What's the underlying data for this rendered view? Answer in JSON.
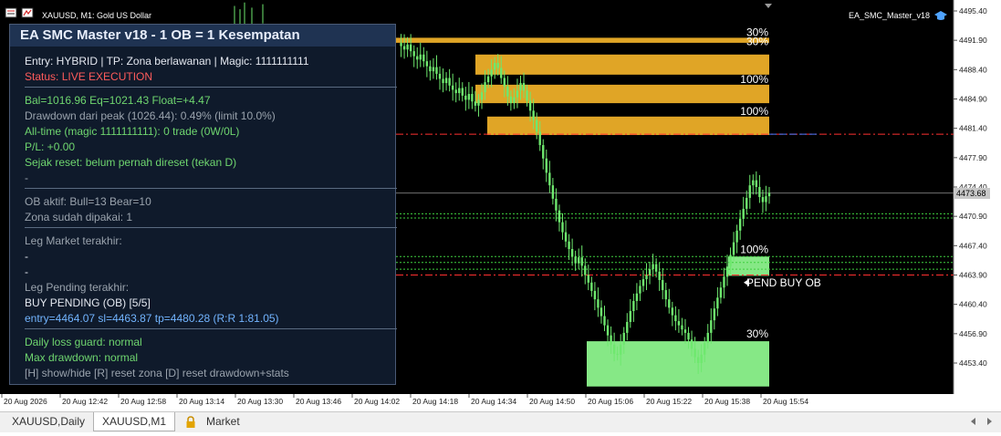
{
  "window": {
    "symbol_title": "XAUUSD, M1:  Gold US Dollar",
    "ea_label": "EA_SMC_Master_v18",
    "current_price": "4473.68"
  },
  "price_axis": {
    "ticks": [
      "4495.40",
      "4491.90",
      "4488.40",
      "4484.90",
      "4481.40",
      "4477.90",
      "4474.40",
      "4470.90",
      "4467.40",
      "4463.90",
      "4460.40",
      "4456.90",
      "4453.40"
    ]
  },
  "time_axis": {
    "ticks": [
      "20 Aug 2026",
      "20 Aug 12:42",
      "20 Aug 12:58",
      "20 Aug 13:14",
      "20 Aug 13:30",
      "20 Aug 13:46",
      "20 Aug 14:02",
      "20 Aug 14:18",
      "20 Aug 14:34",
      "20 Aug 14:50",
      "20 Aug 15:06",
      "20 Aug 15:22",
      "20 Aug 15:38",
      "20 Aug 15:54"
    ]
  },
  "zones": {
    "bear": [
      {
        "label": "30%",
        "label2": "30%",
        "top": 4492.2,
        "bottom": 4491.6
      },
      {
        "label": "",
        "label2": "",
        "top": 4490.2,
        "bottom": 4487.8
      },
      {
        "label": "100%",
        "label2": "",
        "top": 4486.6,
        "bottom": 4484.4
      },
      {
        "label": "100%",
        "label2": "",
        "top": 4482.8,
        "bottom": 4480.6
      }
    ],
    "bull": [
      {
        "label": "100%",
        "top": 4466.1,
        "bottom": 4463.8
      },
      {
        "label": "30%",
        "top": 4456.0,
        "bottom": 4450.6
      }
    ],
    "pending_label": "PEND BUY OB"
  },
  "panel": {
    "title": "EA SMC Master v18  -  1 OB = 1 Kesempatan",
    "entry_line": "Entry: HYBRID  |  TP: Zona berlawanan  |  Magic: 1111111111",
    "status": "Status: LIVE EXECUTION",
    "balance": "Bal=1016.96  Eq=1021.43  Float=+4.47",
    "drawdown": "Drawdown dari peak (1026.44): 0.49%  (limit 10.0%)",
    "alltime": "All-time (magic 1111111111): 0 trade (0W/0L)",
    "pl": "P/L: +0.00",
    "reset": "Sejak reset: belum pernah direset (tekan D)",
    "dash1": "-",
    "ob_active": "OB aktif: Bull=13  Bear=10",
    "zones_used": "Zona sudah dipakai: 1",
    "leg_market_title": "Leg Market terakhir:",
    "dash2": "-",
    "dash3": "-",
    "leg_pending_title": "Leg Pending terakhir:",
    "pending_order": "BUY PENDING (OB) [5/5]",
    "pending_levels": "entry=4464.07  sl=4463.87  tp=4480.28  (R:R 1:81.05)",
    "daily_guard": "Daily loss guard: normal",
    "max_dd": "Max drawdown: normal",
    "hotkeys": "[H] show/hide  [R] reset zona  [D] reset drawdown+stats"
  },
  "tabs": [
    {
      "label": "XAUUSD,Daily",
      "active": false
    },
    {
      "label": "XAUUSD,M1",
      "active": true
    },
    {
      "label": "Market",
      "active": false
    }
  ],
  "colors": {
    "bear_zone": "#e0a526",
    "bull_zone": "#86e886",
    "candle": "#6ee86e",
    "resistance_line": "#ff3030",
    "support_line": "#3fcf3f",
    "panel_bg": "#0f1a2b"
  },
  "price_series": [
    4491.6,
    4491.2,
    4490.8,
    4491.4,
    4490.6,
    4490.0,
    4489.6,
    4490.2,
    4489.4,
    4488.8,
    4488.2,
    4488.7,
    4487.9,
    4487.3,
    4486.8,
    4487.4,
    4486.5,
    4486.0,
    4485.6,
    4486.2,
    4485.3,
    4484.8,
    4485.5,
    4484.6,
    4484.1,
    4484.8,
    4485.7,
    4486.9,
    4487.6,
    4488.4,
    4489.2,
    4488.6,
    4487.4,
    4486.4,
    4485.2,
    4484.4,
    4485.1,
    4485.9,
    4486.8,
    4485.9,
    4484.7,
    4483.5,
    4482.4,
    4481.0,
    4479.4,
    4477.8,
    4476.1,
    4474.6,
    4473.0,
    4471.6,
    4470.2,
    4469.0,
    4467.9,
    4467.0,
    4466.1,
    4465.3,
    4466.0,
    4465.0,
    4463.9,
    4463.0,
    4462.0,
    4461.0,
    4460.0,
    4459.0,
    4457.9,
    4456.7,
    4455.6,
    4454.5,
    4454.4,
    4455.6,
    4457.0,
    4458.3,
    4459.6,
    4460.8,
    4461.7,
    4462.6,
    4463.4,
    4463.9,
    4464.6,
    4465.2,
    4464.3,
    4463.3,
    4462.1,
    4461.0,
    4460.0,
    4459.1,
    4458.4,
    4457.9,
    4457.4,
    4457.0,
    4456.2,
    4455.1,
    4454.1,
    4453.4,
    4454.4,
    4455.8,
    4457.0,
    4458.5,
    4459.9,
    4461.2,
    4462.4,
    4463.7,
    4464.9,
    4466.3,
    4467.8,
    4469.2,
    4470.6,
    4471.8,
    4473.1,
    4474.6,
    4475.2,
    4474.4,
    4473.2,
    4472.6,
    4473.3,
    4473.7
  ]
}
